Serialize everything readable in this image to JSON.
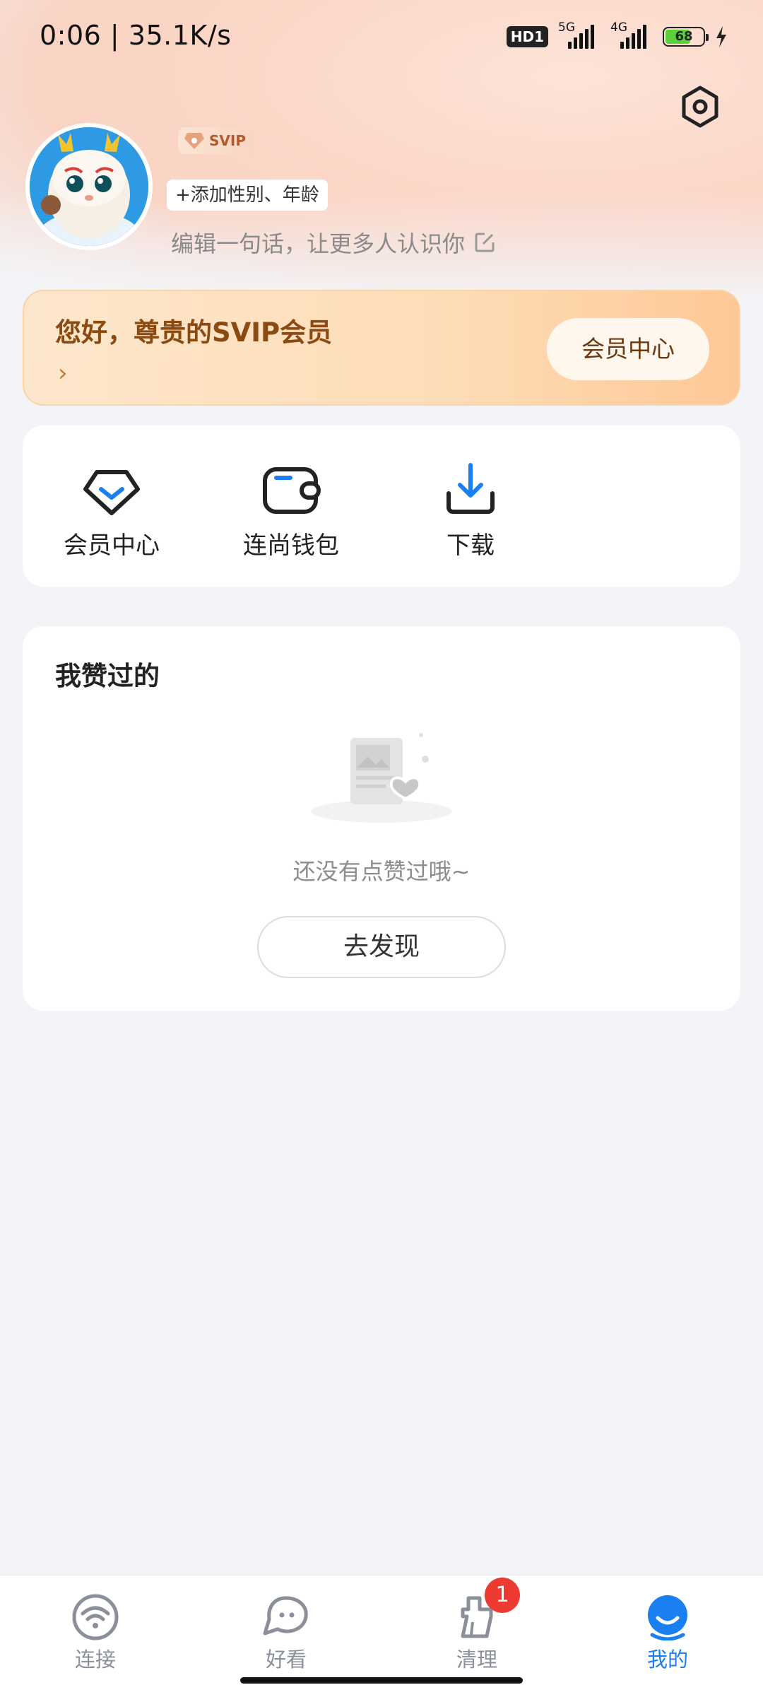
{
  "status_bar": {
    "time_speed": "0:06 | 35.1K/s",
    "hd": "HD1",
    "sim1": "5G",
    "sim2": "4G",
    "battery": "68",
    "battery_level": 0.68
  },
  "profile": {
    "svip_tag": "SVIP",
    "add_info": "+添加性别、年龄",
    "bio_placeholder": "编辑一句话，让更多人认识你"
  },
  "svip_banner": {
    "title": "您好，尊贵的SVIP会员",
    "arrow": "›",
    "button": "会员中心"
  },
  "shortcuts": [
    {
      "label": "会员中心",
      "icon": "vip-diamond-icon"
    },
    {
      "label": "连尚钱包",
      "icon": "wallet-icon"
    },
    {
      "label": "下载",
      "icon": "download-icon"
    }
  ],
  "liked": {
    "title": "我赞过的",
    "empty_text": "还没有点赞过哦~",
    "discover_button": "去发现"
  },
  "bottom_nav": [
    {
      "label": "连接",
      "icon": "wifi-icon",
      "active": false
    },
    {
      "label": "好看",
      "icon": "chat-face-icon",
      "active": false
    },
    {
      "label": "清理",
      "icon": "broom-icon",
      "active": false
    },
    {
      "label": "我的",
      "icon": "profile-icon",
      "active": true
    }
  ],
  "clean_badge": "1",
  "colors": {
    "accent": "#1a7ff0",
    "svip_text": "#8a4a12",
    "badge": "#ee3b31"
  }
}
